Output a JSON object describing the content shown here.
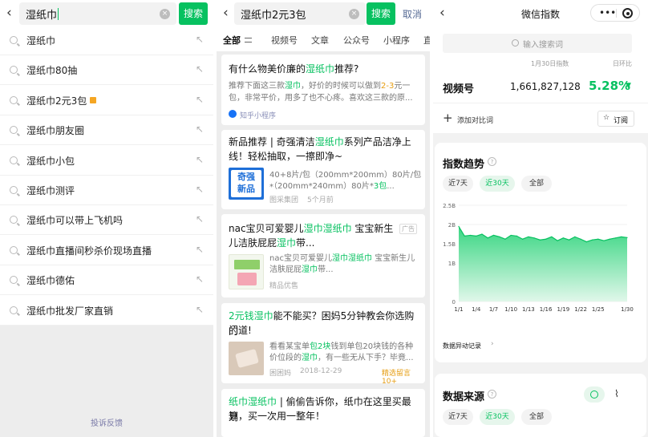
{
  "panel1": {
    "search_value": "湿纸巾",
    "search_button": "搜索",
    "suggestions": [
      "湿纸巾",
      "湿纸巾80抽",
      "湿纸巾2元3包",
      "湿纸巾朋友圈",
      "湿纸巾小包",
      "湿纸巾测评",
      "湿纸巾可以带上飞机吗",
      "湿纸巾直播间秒杀价现场直播",
      "湿纸巾德佑",
      "湿纸巾批发厂家直销"
    ],
    "feedback": "投诉反馈"
  },
  "panel2": {
    "search_value": "湿纸巾2元3包",
    "search_button": "搜索",
    "cancel": "取消",
    "tabs": [
      "全部",
      "视频号",
      "文章",
      "公众号",
      "小程序",
      "直"
    ],
    "card1": {
      "title_a": "有什么物美价廉的",
      "title_hl": "湿纸巾",
      "title_b": "推荐?",
      "line1_a": "推荐下面这三款",
      "line1_hl": "湿巾",
      "line1_b": "，好价的时候可以做到",
      "line1_hl2": "2-3",
      "line1_c": "元一",
      "line2": "包，非常平价，用多了也不心疼。喜欢这三款的原...",
      "source": "知乎小程序"
    },
    "card2": {
      "title_a": "新品推荐 | 奇强清洁",
      "title_hl": "湿纸巾",
      "title_b": "系列产品洁净上",
      "title2": "线！轻松抽取，一擦即净~",
      "thumb_line1": "奇强",
      "thumb_line2": "新品",
      "sum1": "40+8片/包（200mm*200mm）80片/包*",
      "sum2_a": "（200mm*240mm）80片*",
      "sum2_hl": "3包",
      "sum2_b": "...",
      "source": "图采集团",
      "time": "5个月前"
    },
    "card3": {
      "title_a": "nac宝贝可爱婴儿",
      "title_hl": "湿巾湿纸巾",
      "title_b": " 宝宝新生",
      "title2_a": "儿洁肤屁屁",
      "title2_hl": "湿巾",
      "title2_b": "带...",
      "ad": "广告",
      "sum1_a": "nac宝贝可爱婴儿",
      "sum1_hl": "湿巾湿纸巾",
      "sum1_b": " 宝宝新生儿",
      "sum2_a": "洁肤屁屁",
      "sum2_hl": "湿巾",
      "sum2_b": "带...",
      "source": "精品优售"
    },
    "card4": {
      "title_hl": "2元钱湿巾",
      "title_a": "能不能买？困妈5分钟教会你选购的",
      "title2": "门道!",
      "sum1_a": "看看某宝单",
      "sum1_hl": "包2块",
      "sum1_b": "钱到单包20块钱的各种",
      "sum2_a": "价位段的",
      "sum2_hl": "湿巾",
      "sum2_b": "，有一些无从下手？毕竟...",
      "source": "困困妈",
      "time": "2018-12-29",
      "badge": "精选留言10+"
    },
    "card5": {
      "title_hl": "纸巾湿纸巾",
      "title_a": " | 偷偷告诉你，纸巾在这里买最划",
      "title2": "算，买一次用一整年！"
    }
  },
  "panel3": {
    "title": "微信指数",
    "search_placeholder": "输入搜索词",
    "date_label": "1月30日指数",
    "compare_label": "日环比",
    "row": {
      "name": "视频号",
      "value": "1,661,827,128",
      "change": "5.28%",
      "arrow": "▼"
    },
    "add_compare": "添加对比词",
    "subscribe": "订阅",
    "trend_title": "指数趋势",
    "ranges": [
      "近7天",
      "近30天",
      "全部"
    ],
    "anomaly": "数据异动记录",
    "source_title": "数据来源",
    "ranges2": [
      "近7天",
      "近30天",
      "全部"
    ],
    "colors": {
      "accent": "#07c160",
      "chart_fill": "#2fd47c"
    }
  },
  "chart_data": {
    "type": "area",
    "title": "",
    "x": [
      "1/1",
      "1/2",
      "1/3",
      "1/4",
      "1/5",
      "1/6",
      "1/7",
      "1/8",
      "1/9",
      "1/10",
      "1/11",
      "1/12",
      "1/13",
      "1/14",
      "1/15",
      "1/16",
      "1/17",
      "1/18",
      "1/19",
      "1/20",
      "1/21",
      "1/22",
      "1/23",
      "1/24",
      "1/25",
      "1/26",
      "1/27",
      "1/28",
      "1/29",
      "1/30"
    ],
    "x_tick_labels": [
      "1/1",
      "1/4",
      "1/7",
      "1/10",
      "1/13",
      "1/16",
      "1/19",
      "1/22",
      "1/25",
      "1/30"
    ],
    "y_tick_labels": [
      "0",
      "1B",
      "1.5B",
      "2B",
      "2.5B"
    ],
    "series": [
      {
        "values": [
          1.95,
          1.7,
          1.72,
          1.7,
          1.75,
          1.65,
          1.72,
          1.68,
          1.62,
          1.72,
          1.7,
          1.62,
          1.68,
          1.65,
          1.6,
          1.62,
          1.68,
          1.58,
          1.65,
          1.6,
          1.68,
          1.62,
          1.55,
          1.6,
          1.62,
          1.58,
          1.62,
          1.65,
          1.68,
          1.66
        ]
      }
    ],
    "ylim": [
      0,
      2.5
    ],
    "grid": true
  }
}
